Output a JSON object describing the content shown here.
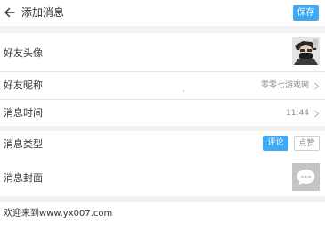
{
  "header": {
    "back_icon": "arrow-left-icon",
    "title": "添加消息",
    "save_label": "保存"
  },
  "fields": {
    "avatar": {
      "label": "好友头像",
      "avatar_icon": "user-avatar"
    },
    "nickname": {
      "label": "好友昵称",
      "value": "零零七游戏网",
      "chevron_icon": "chevron-right-icon"
    },
    "time": {
      "label": "消息时间",
      "value": "11:44",
      "chevron_icon": "chevron-right-icon"
    },
    "type": {
      "label": "消息类型",
      "options": [
        "评论",
        "点赞"
      ],
      "selected": "评论"
    },
    "cover": {
      "label": "消息封面",
      "placeholder_icon": "chat-bubble-icon"
    }
  },
  "content": {
    "text": "欢迎来到www.yx007.com"
  },
  "colors": {
    "accent": "#3fa9f5",
    "background": "#f2f2f2",
    "card": "#ffffff",
    "secondary_text": "#8c8c8c"
  }
}
